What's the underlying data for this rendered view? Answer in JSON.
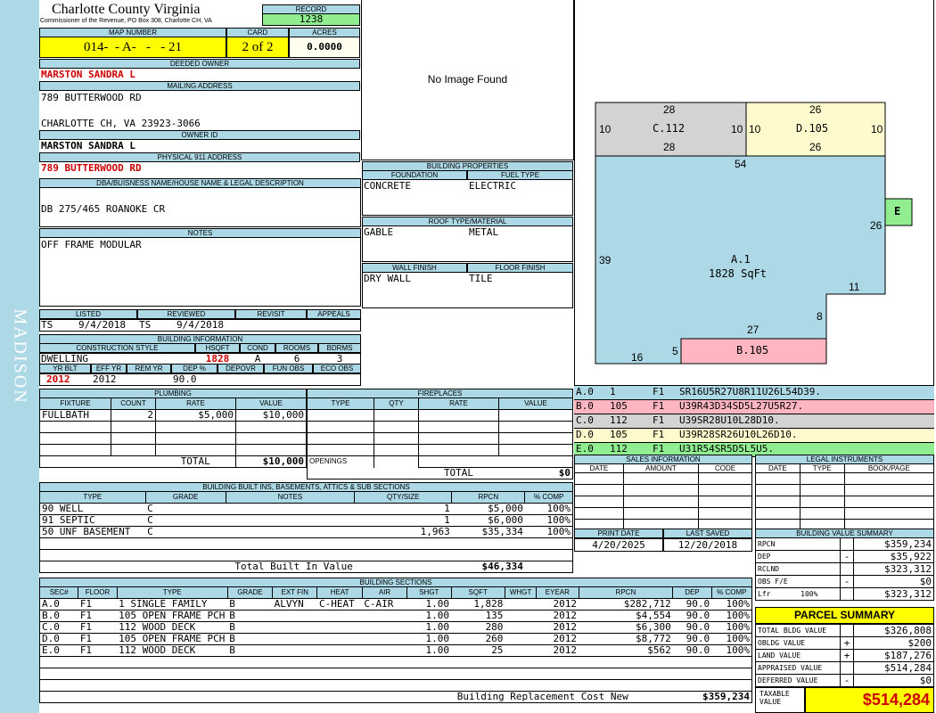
{
  "sidebar": {
    "text": "MADISON"
  },
  "header": {
    "title": "Charlotte County Virginia",
    "subtitle": "Commissioner of the Revenue, PO Box 308, Charlotte CH, VA"
  },
  "record": {
    "label": "RECORD",
    "value": "1238"
  },
  "map": {
    "label": "MAP NUMBER",
    "value": "014-  - A-   -   - 21"
  },
  "card": {
    "label": "CARD",
    "value": "2 of 2"
  },
  "acres": {
    "label": "ACRES",
    "value": "0.0000"
  },
  "owner": {
    "label": "DEEDED OWNER",
    "value": "MARSTON SANDRA L"
  },
  "mailing": {
    "label": "MAILING ADDRESS",
    "line1": "789 BUTTERWOOD RD",
    "line2": "CHARLOTTE CH, VA 23923-3066"
  },
  "owner_id": {
    "label": "OWNER ID",
    "value": "MARSTON SANDRA L"
  },
  "physical": {
    "label": "PHYSICAL 911 ADDRESS",
    "value": "789 BUTTERWOOD RD"
  },
  "dba": {
    "label": "DBA/BUISNESS NAME/HOUSE NAME & LEGAL DESCRIPTION",
    "value": "DB 275/465 ROANOKE CR"
  },
  "notes": {
    "label": "NOTES",
    "value": "OFF FRAME MODULAR"
  },
  "photo": {
    "text": "No Image Found"
  },
  "listing": {
    "listed_label": "LISTED",
    "reviewed_label": "REVIEWED",
    "revisit_label": "REVISIT",
    "appeals_label": "APPEALS",
    "listed_by": "TS",
    "listed_date": "9/4/2018",
    "reviewed_by": "TS",
    "reviewed_date": "9/4/2018"
  },
  "building_info": {
    "label": "BUILDING INFORMATION",
    "style_label": "CONSTRUCTION STYLE",
    "hsqft_label": "HSQFT",
    "cond_label": "COND",
    "rooms_label": "ROOMS",
    "bdrms_label": "BDRMS",
    "style": "DWELLING",
    "hsqft": "1828",
    "cond": "A",
    "rooms": "6",
    "bdrms": "3",
    "yrblt_label": "YR BLT",
    "effyr_label": "EFF YR",
    "remyr_label": "REM YR",
    "dep_label": "DEP %",
    "depovr_label": "DEPOVR",
    "funobs_label": "FUN OBS",
    "ecoobs_label": "ECO OBS",
    "yrblt": "2012",
    "effyr": "2012",
    "dep": "90.0"
  },
  "building_props": {
    "label": "BUILDING PROPERTIES",
    "foundation_label": "FOUNDATION",
    "fuel_label": "FUEL TYPE",
    "foundation": "CONCRETE",
    "fuel": "ELECTRIC",
    "roof_label": "ROOF TYPE/MATERIAL",
    "roof_type": "GABLE",
    "roof_material": "METAL",
    "wall_label": "WALL FINISH",
    "floor_label": "FLOOR FINISH",
    "wall": "DRY WALL",
    "floor": "TILE"
  },
  "plumbing": {
    "label": "PLUMBING",
    "headers": [
      "FIXTURE",
      "COUNT",
      "RATE",
      "VALUE"
    ],
    "rows": [
      [
        "FULLBATH",
        "2",
        "$5,000",
        "$10,000"
      ]
    ],
    "total_label": "TOTAL",
    "total": "$10,000"
  },
  "fireplaces": {
    "label": "FIREPLACES",
    "headers": [
      "TYPE",
      "QTY",
      "RATE",
      "VALUE"
    ],
    "openings_label": "OPENINGS",
    "total_label": "TOTAL",
    "total": "$0"
  },
  "builtins": {
    "label": "BUILDING BUILT INS, BASEMENTS, ATTICS & SUB SECTIONS",
    "headers": [
      "TYPE",
      "GRADE",
      "NOTES",
      "QTY/SIZE",
      "RPCN",
      "% COMP"
    ],
    "rows": [
      [
        "90 WELL",
        "C",
        "",
        "1",
        "$5,000",
        "100%"
      ],
      [
        "91 SEPTIC",
        "C",
        "",
        "1",
        "$6,000",
        "100%"
      ],
      [
        "50 UNF BASEMENT",
        "C",
        "",
        "1,963",
        "$35,334",
        "100%"
      ]
    ],
    "total_label": "Total Built In Value",
    "total": "$46,334"
  },
  "sections": {
    "label": "BUILDING SECTIONS",
    "headers": [
      "SEC#",
      "FLOOR",
      "TYPE",
      "GRADE",
      "EXT FIN",
      "HEAT",
      "AIR",
      "SHGT",
      "SQFT",
      "WHGT",
      "EYEAR",
      "RPCN",
      "DEP",
      "% COMP"
    ],
    "rows": [
      [
        "A.0",
        "F1",
        "1 SINGLE FAMILY",
        "B",
        "ALVYN",
        "C-HEAT",
        "C-AIR",
        "1.00",
        "1,828",
        "",
        "2012",
        "$282,712",
        "90.0",
        "100%"
      ],
      [
        "B.0",
        "F1",
        "105 OPEN FRAME PCH",
        "B",
        "",
        "",
        "",
        "1.00",
        "135",
        "",
        "2012",
        "$4,554",
        "90.0",
        "100%"
      ],
      [
        "C.0",
        "F1",
        "112 WOOD DECK",
        "B",
        "",
        "",
        "",
        "1.00",
        "280",
        "",
        "2012",
        "$6,300",
        "90.0",
        "100%"
      ],
      [
        "D.0",
        "F1",
        "105 OPEN FRAME PCH",
        "B",
        "",
        "",
        "",
        "1.00",
        "260",
        "",
        "2012",
        "$8,772",
        "90.0",
        "100%"
      ],
      [
        "E.0",
        "F1",
        "112 WOOD DECK",
        "B",
        "",
        "",
        "",
        "1.00",
        "25",
        "",
        "2012",
        "$562",
        "90.0",
        "100%"
      ]
    ],
    "total_label": "Building Replacement Cost New",
    "total": "$359,234"
  },
  "sketch": {
    "labels": {
      "c_top": "28",
      "c_left": "10",
      "c_name": "C.112",
      "c_right": "10",
      "c_bottom": "28",
      "d_top": "26",
      "d_left": "10",
      "d_name": "D.105",
      "d_right": "10",
      "d_bottom": "26",
      "a_top": "54",
      "a_left": "39",
      "a_name": "A.1",
      "a_area": "1828 SqFt",
      "a_right": "26",
      "a_step": "11",
      "a_step2": "8",
      "a_bot": "27",
      "b_name": "B.105",
      "b_left": "5",
      "b_bot": "16",
      "e_name": "E"
    },
    "colors": {
      "a": "#add8e6",
      "b": "#ffb6c1",
      "c": "#d3d3d3",
      "d": "#fffacd",
      "e": "#90ee90"
    }
  },
  "sketch_codes": [
    {
      "sec": "A.0",
      "code": "1",
      "floor": "F1",
      "vector": "SR16U5R27U8R11U26L54D39.",
      "color": "#add8e6"
    },
    {
      "sec": "B.0",
      "code": "105",
      "floor": "F1",
      "vector": "U39R43D34SD5L27U5R27.",
      "color": "#ffb6c1"
    },
    {
      "sec": "C.0",
      "code": "112",
      "floor": "F1",
      "vector": "U39SR28U10L28D10.",
      "color": "#d3d3d3"
    },
    {
      "sec": "D.0",
      "code": "105",
      "floor": "F1",
      "vector": "U39R28SR26U10L26D10.",
      "color": "#fffacd"
    },
    {
      "sec": "E.0",
      "code": "112",
      "floor": "F1",
      "vector": "U31R54SR5D5L5U5.",
      "color": "#90ee90"
    }
  ],
  "sales": {
    "label": "SALES INFORMATION",
    "headers": [
      "DATE",
      "AMOUNT",
      "CODE"
    ]
  },
  "legal": {
    "label": "LEGAL INSTRUMENTS",
    "headers": [
      "DATE",
      "TYPE",
      "BOOK/PAGE"
    ]
  },
  "print": {
    "print_label": "PRINT DATE",
    "saved_label": "LAST SAVED",
    "print_date": "4/20/2025",
    "saved_date": "12/20/2018"
  },
  "value_summary": {
    "label": "BUILDING VALUE SUMMARY",
    "rows": [
      [
        "RPCN",
        "",
        "$359,234"
      ],
      [
        "DEP",
        "-",
        "$35,922"
      ],
      [
        "RCLND",
        "",
        "$323,312"
      ],
      [
        "OBS F/E",
        "-",
        "$0"
      ],
      [
        "Lfr       100%",
        "",
        "$323,312"
      ]
    ]
  },
  "parcel": {
    "label": "PARCEL SUMMARY",
    "rows": [
      [
        "TOTAL BLDG VALUE",
        "",
        "$326,808"
      ],
      [
        "OBLDG VALUE",
        "+",
        "$200"
      ],
      [
        "LAND VALUE",
        "+",
        "$187,276"
      ],
      [
        "APPRAISED VALUE",
        "",
        "$514,284"
      ],
      [
        "DEFERRED VALUE",
        "-",
        "$0"
      ]
    ],
    "taxable_label": "TAXABLE VALUE",
    "taxable": "$514,284"
  }
}
